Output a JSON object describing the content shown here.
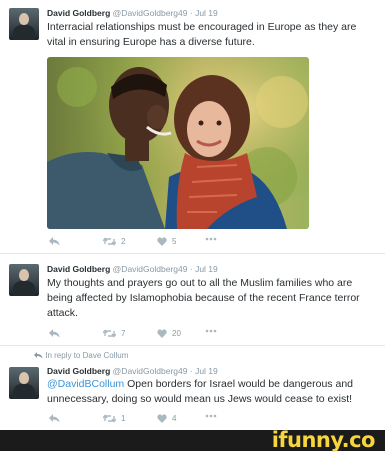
{
  "tweets": [
    {
      "author": "David Goldberg",
      "handle": "@DavidGoldberg49",
      "date": "Jul 19",
      "text": "Interracial relationships must be encouraged in Europe as they are vital in ensuring Europe has a diverse future.",
      "retweets": "2",
      "likes": "5"
    },
    {
      "author": "David Goldberg",
      "handle": "@DavidGoldberg49",
      "date": "Jul 19",
      "text": "My thoughts and prayers go out to all the Muslim families who are being affected by Islamophobia because of the recent France terror attack.",
      "retweets": "7",
      "likes": "20"
    },
    {
      "reply_to": "In reply to Dave Collum",
      "author": "David Goldberg",
      "handle": "@DavidGoldberg49",
      "date": "Jul 19",
      "mention": "@DavidBCollum",
      "text": " Open borders for Israel would be dangerous and unnecessary, doing so would mean us Jews would cease to exist!",
      "retweets": "1",
      "likes": "4"
    }
  ],
  "icons": {
    "reply": "reply-icon",
    "retweet": "retweet-icon",
    "like": "heart-icon",
    "more": "more-icon",
    "reply_indicator": "reply-arrow-icon"
  },
  "colors": {
    "name": "#292f33",
    "meta": "#8899a6",
    "mention": "#3b94d9",
    "separator": "#e1e8ed",
    "watermark": "#f6d63c"
  },
  "watermark": "ifunny.co"
}
